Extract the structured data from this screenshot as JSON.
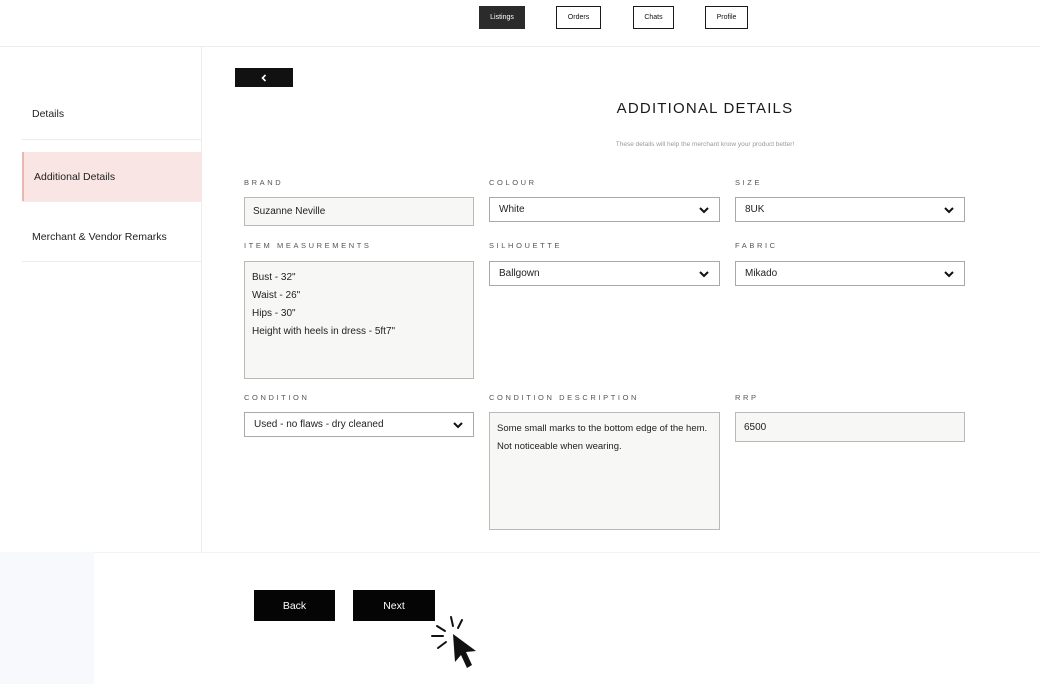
{
  "nav": {
    "items": [
      {
        "label": "Listings",
        "active": true
      },
      {
        "label": "Orders",
        "active": false
      },
      {
        "label": "Chats",
        "active": false
      },
      {
        "label": "Profile",
        "active": false
      }
    ]
  },
  "sidebar": {
    "items": [
      {
        "label": "Details",
        "active": false
      },
      {
        "label": "Additional Details",
        "active": true
      },
      {
        "label": "Merchant & Vendor Remarks",
        "active": false
      }
    ]
  },
  "page": {
    "back_arrow_icon": "chevron-left-icon",
    "title": "ADDITIONAL DETAILS",
    "subtitle": "These details will help the merchant know your product better!"
  },
  "form": {
    "brand": {
      "label": "BRAND",
      "value": "Suzanne Neville"
    },
    "colour": {
      "label": "COLOUR",
      "value": "White"
    },
    "size": {
      "label": "SIZE",
      "value": "8UK"
    },
    "item_measurements": {
      "label": "ITEM MEASUREMENTS",
      "value": "Bust - 32\"\nWaist - 26\"\nHips - 30\"\nHeight with heels in dress - 5ft7\""
    },
    "silhouette": {
      "label": "SILHOUETTE",
      "value": "Ballgown"
    },
    "fabric": {
      "label": "FABRIC",
      "value": "Mikado"
    },
    "condition": {
      "label": "CONDITION",
      "value": "Used - no flaws - dry cleaned"
    },
    "condition_description": {
      "label": "CONDITION DESCRIPTION",
      "value": "Some small marks to the bottom edge of the hem. Not noticeable when wearing."
    },
    "rrp": {
      "label": "RRP",
      "value": "6500"
    }
  },
  "actions": {
    "back_label": "Back",
    "next_label": "Next"
  },
  "colors": {
    "primary": "#050505",
    "active_sidebar_bg": "#f9e6e4",
    "active_sidebar_border": "#e9b8b3",
    "field_bg": "#f7f8f6"
  }
}
